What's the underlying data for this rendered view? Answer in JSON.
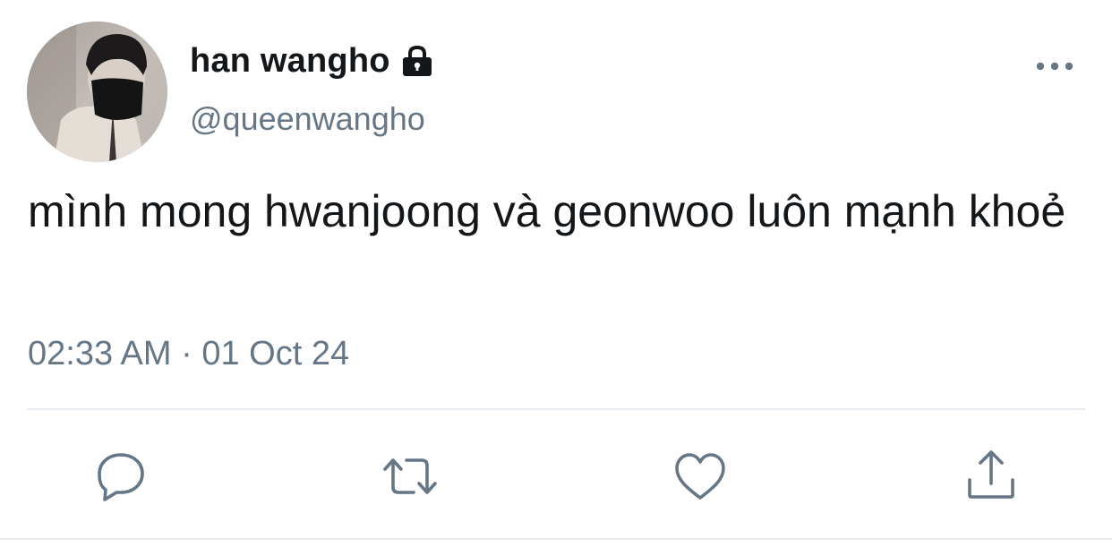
{
  "tweet": {
    "display_name": "han wangho",
    "handle": "@queenwangho",
    "text": "mình mong hwanjoong và geonwoo luôn mạnh khoẻ",
    "timestamp": "02:33 AM · 01 Oct 24",
    "protected_icon": "lock-icon",
    "more_icon": "more-options-icon"
  },
  "actions": [
    {
      "name": "reply",
      "icon": "reply-icon"
    },
    {
      "name": "retweet",
      "icon": "retweet-icon"
    },
    {
      "name": "like",
      "icon": "heart-icon"
    },
    {
      "name": "share",
      "icon": "share-icon"
    }
  ],
  "colors": {
    "primary_text": "#14171a",
    "secondary_text": "#657786",
    "divider": "#e6ecf0"
  }
}
